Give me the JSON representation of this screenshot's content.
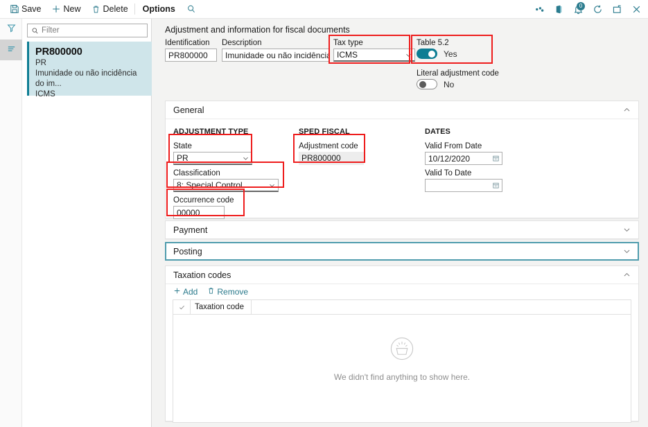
{
  "toolbar": {
    "save_label": "Save",
    "new_label": "New",
    "delete_label": "Delete",
    "options_label": "Options",
    "search_icon": "search-icon",
    "save_icon": "save-disk-icon",
    "new_icon": "plus-icon",
    "delete_icon": "trash-icon",
    "right_icons": [
      {
        "name": "share-icon",
        "glyph": "share"
      },
      {
        "name": "office-app-icon",
        "glyph": "office"
      },
      {
        "name": "notifications-icon",
        "glyph": "bell",
        "badge": "0"
      },
      {
        "name": "refresh-icon",
        "glyph": "refresh"
      },
      {
        "name": "popout-icon",
        "glyph": "popout"
      },
      {
        "name": "close-icon",
        "glyph": "close"
      }
    ]
  },
  "rail": {
    "filter_icon": "funnel-icon",
    "list_icon": "list-lines-icon"
  },
  "list_pane": {
    "filter_placeholder": "Filter",
    "items": [
      {
        "title": "PR800000",
        "line2": "PR",
        "line3": "Imunidade ou não incidência do im...",
        "line4": "ICMS"
      }
    ]
  },
  "page": {
    "title": "Adjustment and information for fiscal documents"
  },
  "header_fields": {
    "identification": {
      "label": "Identification",
      "value": "PR800000"
    },
    "description": {
      "label": "Description",
      "value": "Imunidade ou não incidência..."
    },
    "tax_type": {
      "label": "Tax type",
      "value": "ICMS"
    },
    "table_52": {
      "label": "Table 5.2",
      "state": "Yes"
    },
    "literal_adjustment_code": {
      "label": "Literal adjustment code",
      "state": "No"
    }
  },
  "sections": {
    "general": {
      "title": "General",
      "chevron": "chevron-up-icon",
      "groups": {
        "adjustment_type": {
          "heading": "ADJUSTMENT TYPE",
          "state": {
            "label": "State",
            "value": "PR"
          },
          "classification": {
            "label": "Classification",
            "value": "8: Special Control"
          },
          "occurrence_code": {
            "label": "Occurrence code",
            "value": "00000"
          }
        },
        "sped_fiscal": {
          "heading": "SPED FISCAL",
          "adjustment_code": {
            "label": "Adjustment code",
            "value": "PR800000"
          }
        },
        "dates": {
          "heading": "DATES",
          "valid_from": {
            "label": "Valid From Date",
            "value": "10/12/2020"
          },
          "valid_to": {
            "label": "Valid To Date",
            "value": ""
          }
        }
      }
    },
    "payment": {
      "title": "Payment",
      "chevron": "chevron-down-icon"
    },
    "posting": {
      "title": "Posting",
      "chevron": "chevron-down-icon"
    },
    "taxation_codes": {
      "title": "Taxation codes",
      "chevron": "chevron-up-icon",
      "add_label": "Add",
      "remove_label": "Remove",
      "columns": [
        "Taxation code"
      ],
      "rows": [],
      "empty_message": "We didn't find anything to show here."
    }
  },
  "colors": {
    "accent": "#0d7d93",
    "link": "#2b7a8c",
    "annotation": "#ee1c1c",
    "list_selected": "#cfe5ea",
    "canvas": "#f3f3f2"
  }
}
